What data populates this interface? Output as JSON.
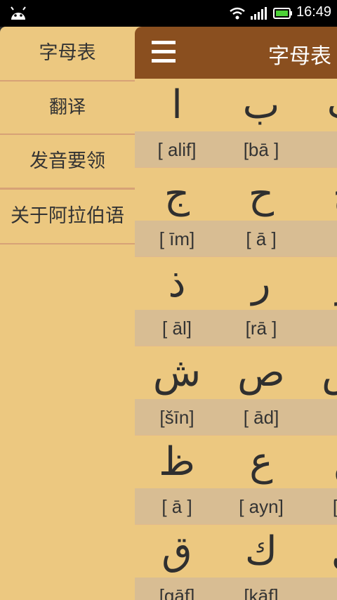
{
  "status_bar": {
    "time": "16:49",
    "icons": [
      "android-icon",
      "wifi-icon",
      "signal-icon",
      "battery-icon"
    ]
  },
  "action_bar": {
    "title": "字母表",
    "menu_icon": "hamburger-menu-icon"
  },
  "drawer": {
    "items": [
      {
        "label": "字母表"
      },
      {
        "label": "翻译"
      },
      {
        "label": "发音要领"
      },
      {
        "label": "关于阿拉伯语"
      }
    ]
  },
  "letters": [
    [
      {
        "ar": "ا",
        "tr": "[ alif]"
      },
      {
        "ar": "ب",
        "tr": "[bā ]"
      },
      {
        "ar": "ت",
        "tr": "[t"
      }
    ],
    [
      {
        "ar": "ج",
        "tr": "[ īm]"
      },
      {
        "ar": "ح",
        "tr": "[ ā ]"
      },
      {
        "ar": "خ",
        "tr": "["
      }
    ],
    [
      {
        "ar": "ذ",
        "tr": "[ āl]"
      },
      {
        "ar": "ر",
        "tr": "[rā ]"
      },
      {
        "ar": "ز",
        "tr": "[z"
      }
    ],
    [
      {
        "ar": "ش",
        "tr": "[šīn]"
      },
      {
        "ar": "ص",
        "tr": "[ ād]"
      },
      {
        "ar": "ض",
        "tr": "["
      }
    ],
    [
      {
        "ar": "ظ",
        "tr": "[ ā ]"
      },
      {
        "ar": "ع",
        "tr": "[ ayn]"
      },
      {
        "ar": "غ",
        "tr": "[ġa"
      }
    ],
    [
      {
        "ar": "ق",
        "tr": "[qāf]"
      },
      {
        "ar": "ك",
        "tr": "[kāf]"
      },
      {
        "ar": "ل",
        "tr": "[l"
      }
    ]
  ],
  "colors": {
    "background": "#ecc880",
    "translit_band": "#d8bd93",
    "action_bar": "#8a4f1f",
    "divider": "#d7a276"
  }
}
